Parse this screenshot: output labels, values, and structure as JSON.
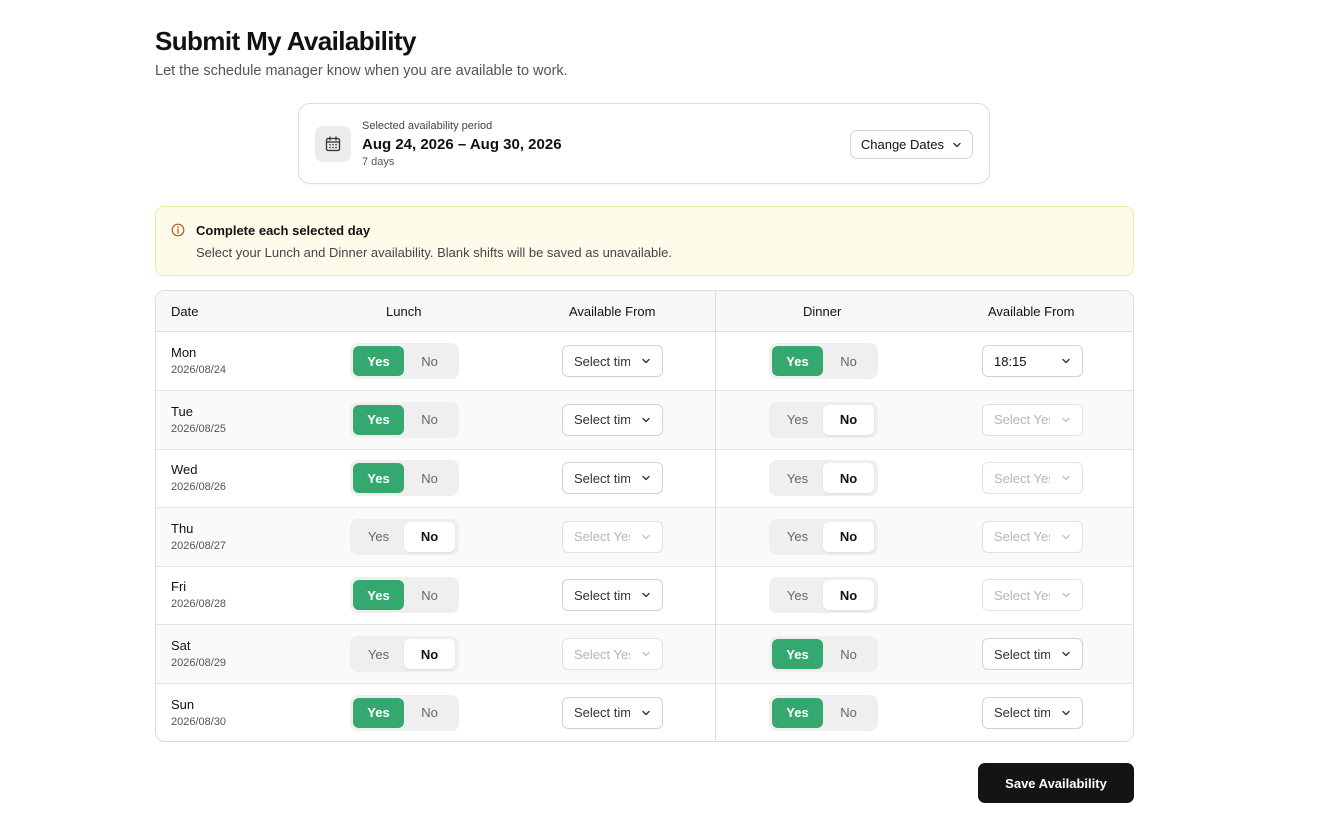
{
  "header": {
    "title": "Submit My Availability",
    "subtitle": "Let the schedule manager know when you are available to work."
  },
  "period": {
    "label": "Selected availability period",
    "range": "Aug 24, 2026 – Aug 30, 2026",
    "days": "7 days",
    "change_label": "Change Dates",
    "icon": "calendar-icon"
  },
  "notice": {
    "title": "Complete each selected day",
    "text": "Select your Lunch and Dinner availability. Blank shifts will be saved as unavailable.",
    "icon": "info-icon"
  },
  "table": {
    "headers": {
      "date": "Date",
      "lunch": "Lunch",
      "lunch_from": "Available From",
      "dinner": "Dinner",
      "dinner_from": "Available From"
    },
    "yes_label": "Yes",
    "no_label": "No",
    "rows": [
      {
        "day": "Mon",
        "date": "2026/08/24",
        "lunch": "yes",
        "lunch_from": "Select time",
        "dinner": "yes",
        "dinner_from": "18:15"
      },
      {
        "day": "Tue",
        "date": "2026/08/25",
        "lunch": "yes",
        "lunch_from": "Select time",
        "dinner": "no",
        "dinner_from": "Select Yes first"
      },
      {
        "day": "Wed",
        "date": "2026/08/26",
        "lunch": "yes",
        "lunch_from": "Select time",
        "dinner": "no",
        "dinner_from": "Select Yes first"
      },
      {
        "day": "Thu",
        "date": "2026/08/27",
        "lunch": "no",
        "lunch_from": "Select Yes first",
        "dinner": "no",
        "dinner_from": "Select Yes first"
      },
      {
        "day": "Fri",
        "date": "2026/08/28",
        "lunch": "yes",
        "lunch_from": "Select time",
        "dinner": "no",
        "dinner_from": "Select Yes first"
      },
      {
        "day": "Sat",
        "date": "2026/08/29",
        "lunch": "no",
        "lunch_from": "Select Yes first",
        "dinner": "yes",
        "dinner_from": "Select time"
      },
      {
        "day": "Sun",
        "date": "2026/08/30",
        "lunch": "yes",
        "lunch_from": "Select time",
        "dinner": "yes",
        "dinner_from": "Select time"
      }
    ]
  },
  "actions": {
    "save_label": "Save Availability"
  },
  "colors": {
    "accent_green": "#34a86f",
    "notice_bg": "#fffbeb",
    "save_bg": "#141414"
  }
}
